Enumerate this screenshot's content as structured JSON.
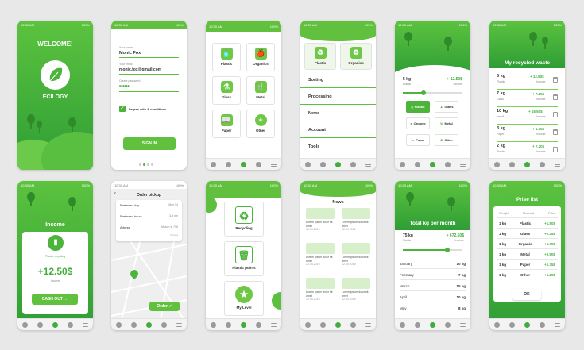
{
  "status": {
    "time": "10:30 AM",
    "battery": "100%"
  },
  "welcome": {
    "title": "WELCOME!",
    "brand": "ECILOGY"
  },
  "signup": {
    "name_label": "Your name",
    "name_value": "Monic Fox",
    "email_label": "Your email",
    "email_value": "monic.fox@gmail.com",
    "password_label": "Create password",
    "password_value": "••••••",
    "agree": "I agree with & conditions",
    "button": "SIGN IN"
  },
  "categories": [
    {
      "label": "Plastic",
      "icon": "🧴"
    },
    {
      "label": "Organics",
      "icon": "🍎"
    },
    {
      "label": "Glass",
      "icon": "⚗"
    },
    {
      "label": "Metal",
      "icon": "🍴"
    },
    {
      "label": "Paper",
      "icon": "📖"
    },
    {
      "label": "Other",
      "icon": "+"
    }
  ],
  "menu": {
    "tiles": [
      "Plastic",
      "Organics"
    ],
    "items": [
      "Sorting",
      "Processing",
      "News",
      "Account",
      "Tools"
    ]
  },
  "calc": {
    "weight": "5 kg",
    "weight_sub": "Plastic",
    "amount": "+ 12.50$",
    "amount_sub": "Income",
    "slider_fraction": 0.35,
    "options": [
      "Plastic",
      "Glass",
      "Organic",
      "Metal",
      "Paper",
      "Other"
    ]
  },
  "recycled": {
    "title": "My recycled waste",
    "rows": [
      {
        "kg": "5 kg",
        "type": "Plastic",
        "amount": "+ 12.50$",
        "sub": "Income"
      },
      {
        "kg": "7 kg",
        "type": "Glass",
        "amount": "+ 7.25$",
        "sub": "Income"
      },
      {
        "kg": "10 kg",
        "type": "metall",
        "amount": "+ 15.50$",
        "sub": "Income"
      },
      {
        "kg": "3 kg",
        "type": "Paper",
        "amount": "+ 1.75$",
        "sub": "Income"
      },
      {
        "kg": "2 kg",
        "type": "Plastic",
        "amount": "+ 7.20$",
        "sub": "Income"
      }
    ]
  },
  "income": {
    "title": "Income",
    "category": "Plastic recycling",
    "amount": "+12.50$",
    "amount_sub": "Income",
    "button": "CASH OUT →"
  },
  "pickup": {
    "title": "Order pickup",
    "rows": [
      {
        "label": "Preferred day",
        "value": "Mon 04"
      },
      {
        "label": "Preferred hours",
        "value": "3-5 pm"
      },
      {
        "label": "Adress",
        "value": "Mason st 796"
      }
    ],
    "extra": "Victoria",
    "button": "Order ✓"
  },
  "points": {
    "items": [
      "Recycling",
      "Plastic points",
      "My Level"
    ]
  },
  "news": {
    "title": "News",
    "items": [
      {
        "text": "Lorem ipsum dolor sit amet",
        "date": "12.04.2019"
      },
      {
        "text": "Lorem ipsum dolor sit amet",
        "date": "12.04.2019"
      },
      {
        "text": "Lorem ipsum dolor sit amet",
        "date": "12.04.2019"
      },
      {
        "text": "Lorem ipsum dolor sit amet",
        "date": "12.04.2019"
      },
      {
        "text": "Lorem ipsum dolor sit amet",
        "date": "12.04.2019"
      },
      {
        "text": "Lorem ipsum dolor sit amet",
        "date": "12.04.2019"
      }
    ]
  },
  "monthly": {
    "title": "Total kg per month",
    "weight": "75 kg",
    "weight_sub": "Plastic",
    "amount": "+ 672.50$",
    "amount_sub": "Income",
    "slider_fraction": 0.75,
    "rows": [
      {
        "month": "January",
        "kg": "10 kg"
      },
      {
        "month": "February",
        "kg": "7 kg"
      },
      {
        "month": "March",
        "kg": "15 kg"
      },
      {
        "month": "April",
        "kg": "10 kg"
      },
      {
        "month": "May",
        "kg": "8 kg"
      }
    ]
  },
  "prices": {
    "title": "Prise list",
    "headers": [
      "Weight",
      "Material",
      "Price"
    ],
    "rows": [
      [
        "1 kg",
        "Plastic",
        "+1.50$"
      ],
      [
        "1 kg",
        "Glass",
        "+2.25$"
      ],
      [
        "1 kg",
        "Organic",
        "+1.75$"
      ],
      [
        "1 kg",
        "Metal",
        "+0.50$"
      ],
      [
        "1 kg",
        "Paper",
        "+1.75$"
      ],
      [
        "1 kg",
        "Other",
        "+1.25$"
      ]
    ],
    "button": "OK"
  },
  "colors": {
    "primary": "#4cb43a",
    "dark": "#2e9d35",
    "light": "#d7efcb"
  }
}
